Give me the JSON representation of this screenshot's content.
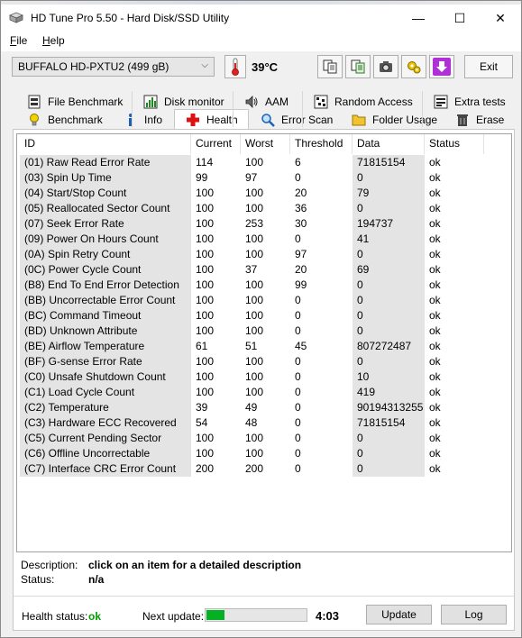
{
  "window": {
    "title": "HD Tune Pro 5.50 - Hard Disk/SSD Utility",
    "minimize": "—",
    "maximize": "☐",
    "close": "✕"
  },
  "menu": [
    {
      "label": "File",
      "underline": "F",
      "rest": "ile"
    },
    {
      "label": "Help",
      "underline": "H",
      "rest": "elp"
    }
  ],
  "toolbar": {
    "drive": "BUFFALO HD-PXTU2 (499 gB)",
    "temperature": "39°C",
    "exit_label": "Exit",
    "icons": [
      "copy-icon",
      "copy-all-icon",
      "camera-icon",
      "options-icon",
      "download-icon"
    ]
  },
  "tabs_top": [
    "File Benchmark",
    "Disk monitor",
    "AAM",
    "Random Access",
    "Extra tests"
  ],
  "tabs_bottom": [
    "Benchmark",
    "Info",
    "Health",
    "Error Scan",
    "Folder Usage",
    "Erase"
  ],
  "active_tab": "Health",
  "table": {
    "columns": [
      "ID",
      "Current",
      "Worst",
      "Threshold",
      "Data",
      "Status"
    ],
    "rows": [
      [
        "(01) Raw Read Error Rate",
        "114",
        "100",
        "6",
        "71815154",
        "ok"
      ],
      [
        "(03) Spin Up Time",
        "99",
        "97",
        "0",
        "0",
        "ok"
      ],
      [
        "(04) Start/Stop Count",
        "100",
        "100",
        "20",
        "79",
        "ok"
      ],
      [
        "(05) Reallocated Sector Count",
        "100",
        "100",
        "36",
        "0",
        "ok"
      ],
      [
        "(07) Seek Error Rate",
        "100",
        "253",
        "30",
        "194737",
        "ok"
      ],
      [
        "(09) Power On Hours Count",
        "100",
        "100",
        "0",
        "41",
        "ok"
      ],
      [
        "(0A) Spin Retry Count",
        "100",
        "100",
        "97",
        "0",
        "ok"
      ],
      [
        "(0C) Power Cycle Count",
        "100",
        "37",
        "20",
        "69",
        "ok"
      ],
      [
        "(B8) End To End Error Detection",
        "100",
        "100",
        "99",
        "0",
        "ok"
      ],
      [
        "(BB) Uncorrectable Error Count",
        "100",
        "100",
        "0",
        "0",
        "ok"
      ],
      [
        "(BC) Command Timeout",
        "100",
        "100",
        "0",
        "0",
        "ok"
      ],
      [
        "(BD) Unknown Attribute",
        "100",
        "100",
        "0",
        "0",
        "ok"
      ],
      [
        "(BE) Airflow Temperature",
        "61",
        "51",
        "45",
        "807272487",
        "ok"
      ],
      [
        "(BF) G-sense Error Rate",
        "100",
        "100",
        "0",
        "0",
        "ok"
      ],
      [
        "(C0) Unsafe Shutdown Count",
        "100",
        "100",
        "0",
        "10",
        "ok"
      ],
      [
        "(C1) Load Cycle Count",
        "100",
        "100",
        "0",
        "419",
        "ok"
      ],
      [
        "(C2) Temperature",
        "39",
        "49",
        "0",
        "90194313255",
        "ok"
      ],
      [
        "(C3) Hardware ECC Recovered",
        "54",
        "48",
        "0",
        "71815154",
        "ok"
      ],
      [
        "(C5) Current Pending Sector",
        "100",
        "100",
        "0",
        "0",
        "ok"
      ],
      [
        "(C6) Offline Uncorrectable",
        "100",
        "100",
        "0",
        "0",
        "ok"
      ],
      [
        "(C7) Interface CRC Error Count",
        "200",
        "200",
        "0",
        "0",
        "ok"
      ]
    ]
  },
  "description": {
    "label": "Description:",
    "value": "click on an item for a detailed description"
  },
  "status": {
    "label": "Status:",
    "value": "n/a"
  },
  "footer": {
    "health_label": "Health status:",
    "health_value": "ok",
    "next_update_label": "Next update:",
    "progress_fraction": 0.18,
    "countdown": "4:03",
    "update_label": "Update",
    "log_label": "Log"
  },
  "colors": {
    "health_ok": "#00a000",
    "progress": "#06b025",
    "id_column_bg": "#e4e4e4",
    "download_btn": "#b030d8"
  }
}
